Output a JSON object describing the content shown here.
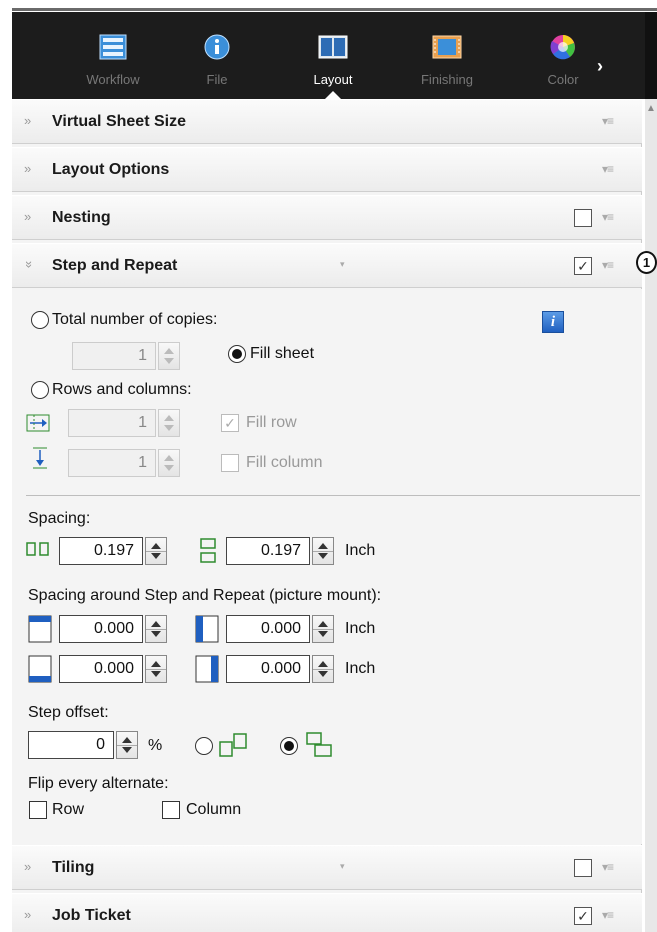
{
  "toolbar": {
    "tabs": [
      {
        "label": "Workflow",
        "icon": "workflow-icon",
        "active": false
      },
      {
        "label": "File",
        "icon": "info-icon",
        "active": false
      },
      {
        "label": "Layout",
        "icon": "layout-icon",
        "active": true
      },
      {
        "label": "Finishing",
        "icon": "finishing-icon",
        "active": false
      },
      {
        "label": "Color",
        "icon": "color-wheel-icon",
        "active": false
      }
    ],
    "next_glyph": "›"
  },
  "sections": {
    "virtual_sheet": {
      "title": "Virtual Sheet Size"
    },
    "layout_options": {
      "title": "Layout Options"
    },
    "nesting": {
      "title": "Nesting",
      "checked": false
    },
    "step_repeat": {
      "title": "Step and Repeat",
      "checked": true
    },
    "tiling": {
      "title": "Tiling",
      "checked": false
    },
    "job_ticket": {
      "title": "Job Ticket",
      "checked": true
    }
  },
  "callout": {
    "number": "1"
  },
  "step_repeat": {
    "total_copies_label": "Total number of copies:",
    "copies_value": "1",
    "fill_sheet_label": "Fill sheet",
    "rows_columns_label": "Rows and columns:",
    "rows_value": "1",
    "columns_value": "1",
    "fill_row_label": "Fill row",
    "fill_column_label": "Fill column",
    "info_glyph": "i",
    "spacing_label": "Spacing:",
    "spacing_h": "0.197",
    "spacing_v": "0.197",
    "spacing_unit": "Inch",
    "mount_label": "Spacing around Step and Repeat (picture mount):",
    "mount_top": "0.000",
    "mount_left": "0.000",
    "mount_bottom": "0.000",
    "mount_right": "0.000",
    "mount_unit_1": "Inch",
    "mount_unit_2": "Inch",
    "step_offset_label": "Step offset:",
    "step_offset_value": "0",
    "step_offset_unit": "%",
    "flip_label": "Flip every alternate:",
    "flip_row_label": "Row",
    "flip_column_label": "Column"
  },
  "colors": {
    "accent_green": "#2e8b2e",
    "accent_blue": "#1f5fc0",
    "toolbar_bg": "#1c1c1c"
  }
}
